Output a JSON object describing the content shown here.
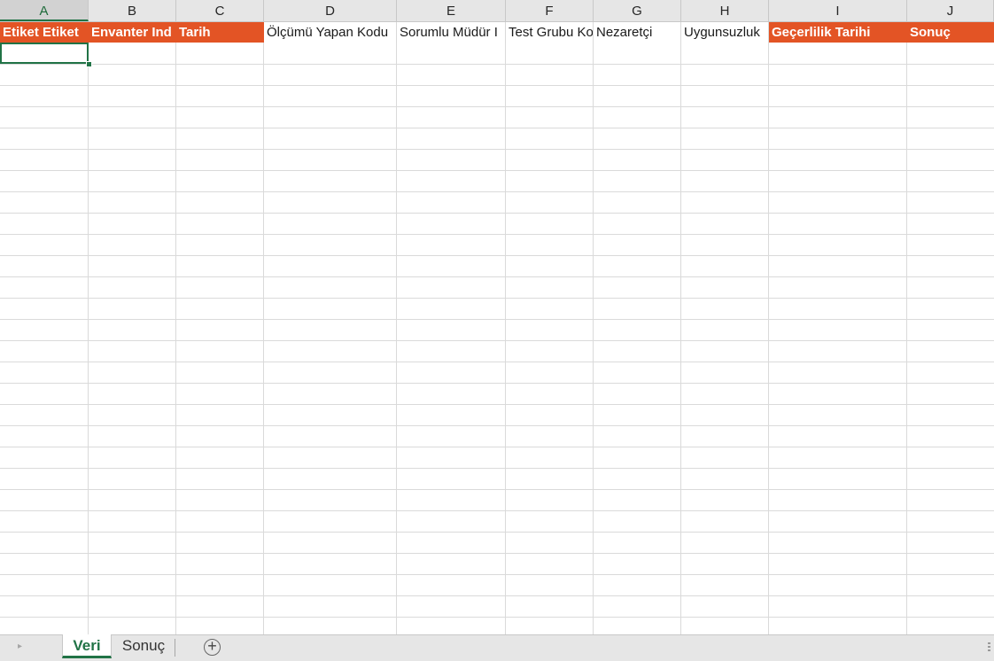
{
  "columns": [
    "A",
    "B",
    "C",
    "D",
    "E",
    "F",
    "G",
    "H",
    "I",
    "J"
  ],
  "header_cells": [
    {
      "text": "Etiket Etiket",
      "style": "orange"
    },
    {
      "text": "Envanter Ind",
      "style": "orange"
    },
    {
      "text": "Tarih",
      "style": "orange"
    },
    {
      "text": "Ölçümü Yapan Kodu",
      "style": "plain"
    },
    {
      "text": "Sorumlu Müdür I",
      "style": "plain"
    },
    {
      "text": "Test Grubu Ko",
      "style": "plain"
    },
    {
      "text": "Nezaretçi",
      "style": "plain"
    },
    {
      "text": "Uygunsuzluk",
      "style": "plain"
    },
    {
      "text": "Geçerlilik Tarihi",
      "style": "orange"
    },
    {
      "text": "Sonuç",
      "style": "orange"
    }
  ],
  "selected_cell": "A2",
  "sheet_tabs": [
    {
      "label": "Veri",
      "active": true
    },
    {
      "label": "Sonuç",
      "active": false
    }
  ],
  "add_sheet_symbol": "+",
  "nav_arrow_symbol": "▸",
  "colors": {
    "accent": "#217346",
    "header_fill": "#e35425",
    "gridline": "#dadada"
  }
}
